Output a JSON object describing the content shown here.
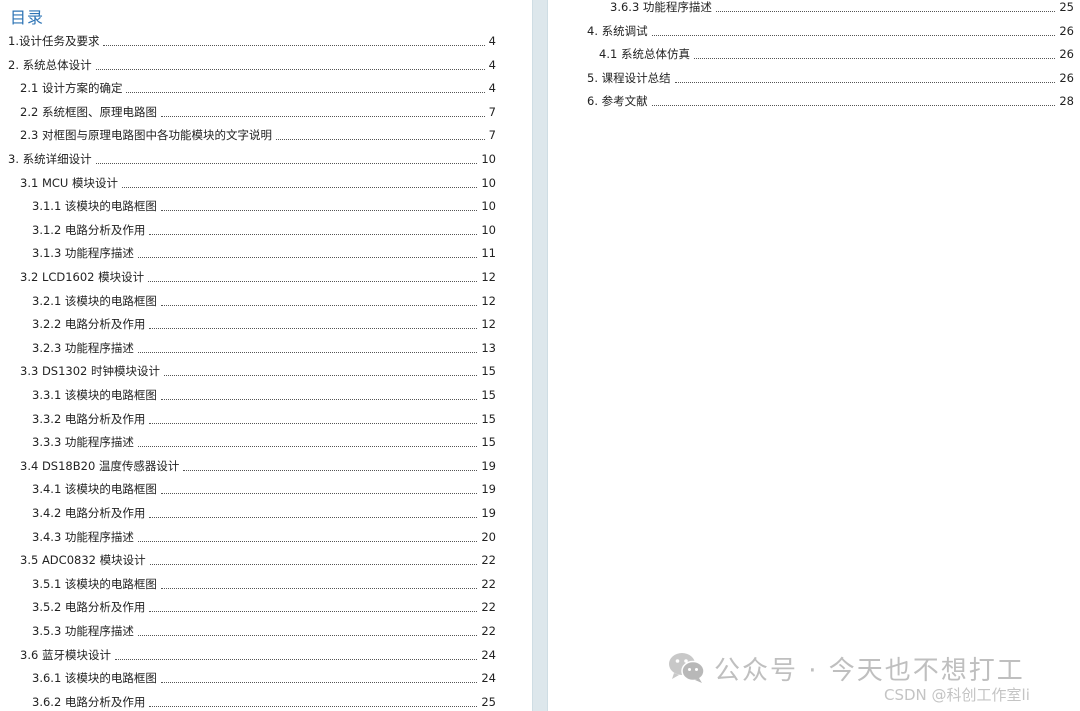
{
  "toc": {
    "title": "目录",
    "left_entries": [
      {
        "text": "1.设计任务及要求",
        "page": "4",
        "level": 1
      },
      {
        "text": "2. 系统总体设计",
        "page": "4",
        "level": 1
      },
      {
        "text": "2.1 设计方案的确定",
        "page": "4",
        "level": 2
      },
      {
        "text": "2.2 系统框图、原理电路图",
        "page": "7",
        "level": 2
      },
      {
        "text": "2.3 对框图与原理电路图中各功能模块的文字说明",
        "page": "7",
        "level": 2
      },
      {
        "text": "3. 系统详细设计",
        "page": "10",
        "level": 1
      },
      {
        "text": "3.1 MCU 模块设计",
        "page": "10",
        "level": 2
      },
      {
        "text": "3.1.1 该模块的电路框图",
        "page": "10",
        "level": 3
      },
      {
        "text": "3.1.2 电路分析及作用",
        "page": "10",
        "level": 3
      },
      {
        "text": "3.1.3 功能程序描述",
        "page": "11",
        "level": 3
      },
      {
        "text": "3.2 LCD1602 模块设计",
        "page": "12",
        "level": 2
      },
      {
        "text": "3.2.1 该模块的电路框图",
        "page": "12",
        "level": 3
      },
      {
        "text": "3.2.2 电路分析及作用",
        "page": "12",
        "level": 3
      },
      {
        "text": "3.2.3 功能程序描述",
        "page": "13",
        "level": 3
      },
      {
        "text": "3.3 DS1302 时钟模块设计",
        "page": "15",
        "level": 2
      },
      {
        "text": "3.3.1 该模块的电路框图",
        "page": "15",
        "level": 3
      },
      {
        "text": "3.3.2 电路分析及作用",
        "page": "15",
        "level": 3
      },
      {
        "text": "3.3.3 功能程序描述",
        "page": "15",
        "level": 3
      },
      {
        "text": "3.4 DS18B20 温度传感器设计",
        "page": "19",
        "level": 2
      },
      {
        "text": "3.4.1 该模块的电路框图",
        "page": "19",
        "level": 3
      },
      {
        "text": "3.4.2 电路分析及作用",
        "page": "19",
        "level": 3
      },
      {
        "text": "3.4.3 功能程序描述",
        "page": "20",
        "level": 3
      },
      {
        "text": "3.5 ADC0832 模块设计",
        "page": "22",
        "level": 2
      },
      {
        "text": "3.5.1 该模块的电路框图",
        "page": "22",
        "level": 3
      },
      {
        "text": "3.5.2 电路分析及作用",
        "page": "22",
        "level": 3
      },
      {
        "text": "3.5.3 功能程序描述",
        "page": "22",
        "level": 3
      },
      {
        "text": "3.6 蓝牙模块设计",
        "page": "24",
        "level": 2
      },
      {
        "text": "3.6.1 该模块的电路框图",
        "page": "24",
        "level": 3
      },
      {
        "text": "3.6.2 电路分析及作用",
        "page": "25",
        "level": 3
      }
    ],
    "right_entries": [
      {
        "text": "3.6.3 功能程序描述",
        "page": "25",
        "level": 3
      },
      {
        "text": "4. 系统调试",
        "page": "26",
        "level": 1
      },
      {
        "text": "4.1 系统总体仿真",
        "page": "26",
        "level": 2
      },
      {
        "text": "5. 课程设计总结",
        "page": "26",
        "level": 1
      },
      {
        "text": "6. 参考文献",
        "page": "28",
        "level": 1
      }
    ]
  },
  "watermark": {
    "icon": "wechat-icon",
    "text": "公众号 · 今天也不想打工",
    "sub": "CSDN @科创工作室li"
  }
}
